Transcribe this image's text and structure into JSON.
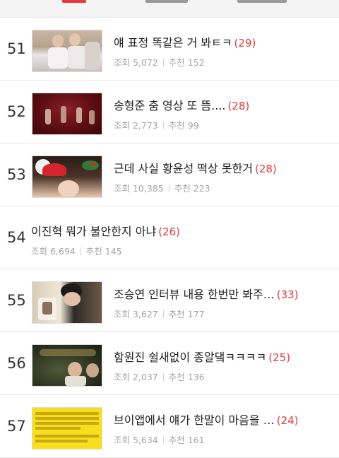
{
  "list": {
    "rows": [
      {
        "rank": "51",
        "title": "얘 표정 똑같은 거 봐ㅌㅋ",
        "count": "(29)",
        "views": "조회 5,072",
        "recommend": "추천 152"
      },
      {
        "rank": "52",
        "title": "송형준 춤 영상 또 뜸....",
        "count": "(28)",
        "views": "조회 2,773",
        "recommend": "추천 99"
      },
      {
        "rank": "53",
        "title": "근데 사실 황윤성 떡상 못한거",
        "count": "(28)",
        "views": "조회 10,385",
        "recommend": "추천 223"
      },
      {
        "rank": "54",
        "title": "이진혁 뭐가 불안한지 아냐",
        "count": "(26)",
        "views": "조회 6,694",
        "recommend": "추천 145"
      },
      {
        "rank": "55",
        "title": "조승연 인터뷰 내용 한번만 봐주…",
        "count": "(33)",
        "views": "조회 3,627",
        "recommend": "추천 177"
      },
      {
        "rank": "56",
        "title": "함원진 쉴새없이 종알댘ㅋㅋㅋㅋ",
        "count": "(25)",
        "views": "조회 2,037",
        "recommend": "추천 136"
      },
      {
        "rank": "57",
        "title": "브이앱에서 얘가 한말이 마음을 …",
        "count": "(24)",
        "views": "조회 5,634",
        "recommend": "추천 161"
      }
    ]
  },
  "accent_color": "#e23a3a"
}
